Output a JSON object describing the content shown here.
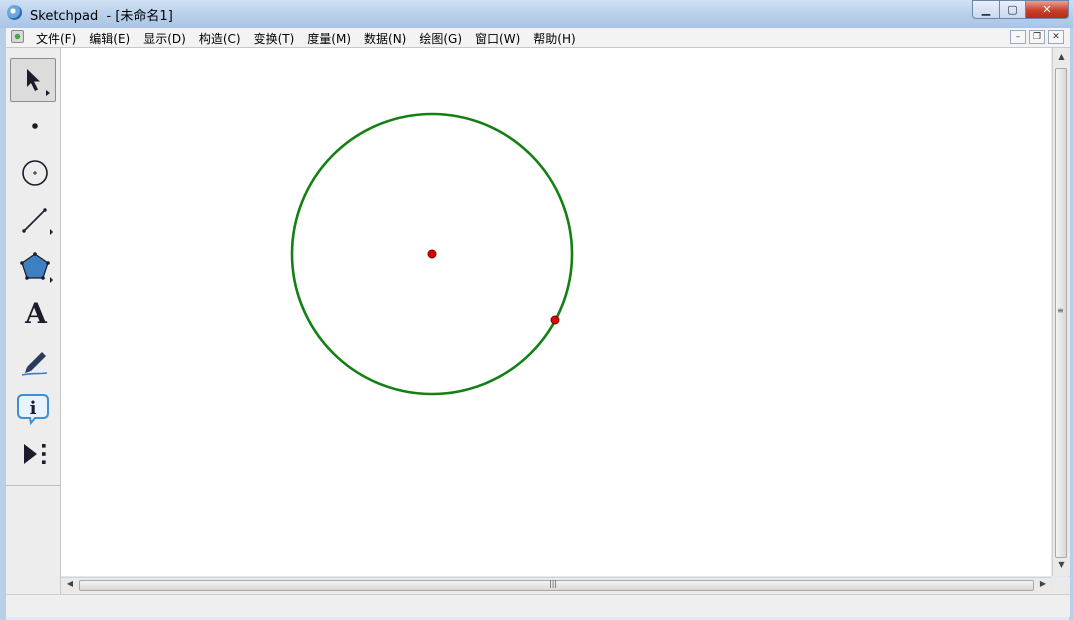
{
  "window": {
    "title": "Sketchpad  - [未命名1]",
    "min_glyph": "▁",
    "max_glyph": "▢",
    "close_glyph": "✕"
  },
  "menu": {
    "items": [
      "文件(F)",
      "编辑(E)",
      "显示(D)",
      "构造(C)",
      "变换(T)",
      "度量(M)",
      "数据(N)",
      "绘图(G)",
      "窗口(W)",
      "帮助(H)"
    ],
    "doc_min_glyph": "–",
    "doc_restore_glyph": "❐",
    "doc_close_glyph": "✕"
  },
  "tools": [
    {
      "name": "arrow-tool",
      "icon": "arrow-icon"
    },
    {
      "name": "point-tool",
      "icon": "point-icon"
    },
    {
      "name": "compass-tool",
      "icon": "circle-icon"
    },
    {
      "name": "straightedge-tool",
      "icon": "line-icon"
    },
    {
      "name": "polygon-tool",
      "icon": "pentagon-icon"
    },
    {
      "name": "text-tool",
      "icon": "text-icon",
      "glyph": "A"
    },
    {
      "name": "marker-tool",
      "icon": "marker-icon"
    },
    {
      "name": "information-tool",
      "icon": "info-icon",
      "glyph": "i"
    },
    {
      "name": "custom-tool",
      "icon": "custom-tools-icon"
    }
  ],
  "colors": {
    "circle_stroke": "#138013",
    "point_fill": "#e00000",
    "point_stroke": "#7a0000"
  }
}
